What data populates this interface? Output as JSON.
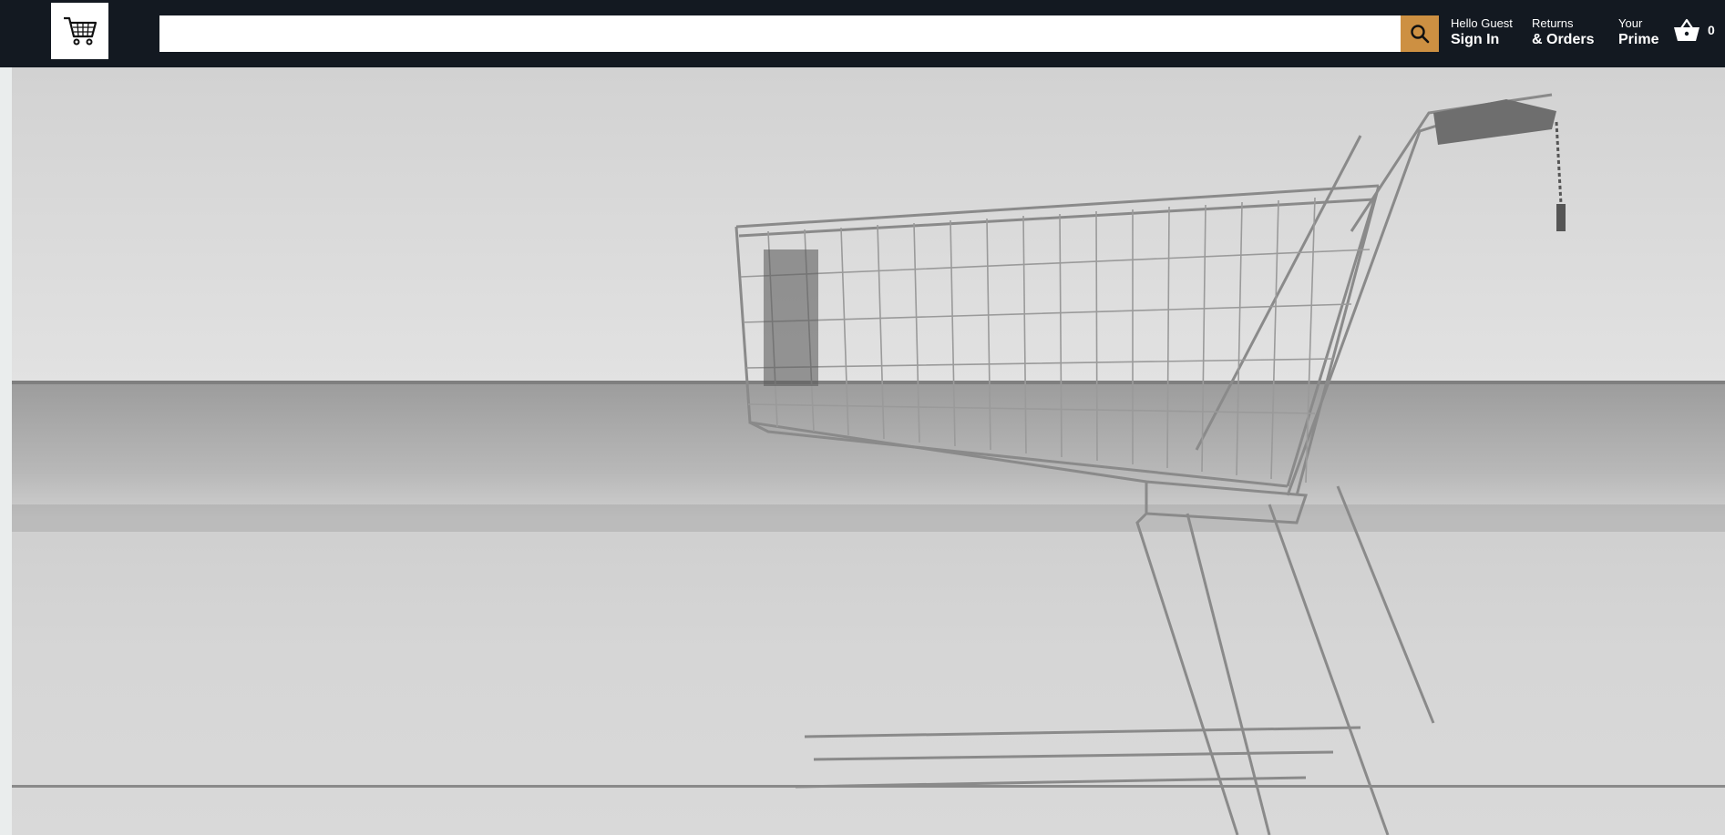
{
  "header": {
    "logo_icon": "shopping-cart-icon",
    "search": {
      "value": "",
      "placeholder": "",
      "button_icon": "search-icon"
    },
    "nav": [
      {
        "line1": "Hello Guest",
        "line2": "Sign In"
      },
      {
        "line1": "Returns",
        "line2": "& Orders"
      },
      {
        "line1": "Your",
        "line2": "Prime"
      }
    ],
    "basket": {
      "icon": "basket-icon",
      "count": "0"
    }
  },
  "hero": {
    "image": "shopping-cart-photo"
  },
  "colors": {
    "header_bg": "#131921",
    "search_button": "#cd9042",
    "page_bg": "#eaeded"
  }
}
